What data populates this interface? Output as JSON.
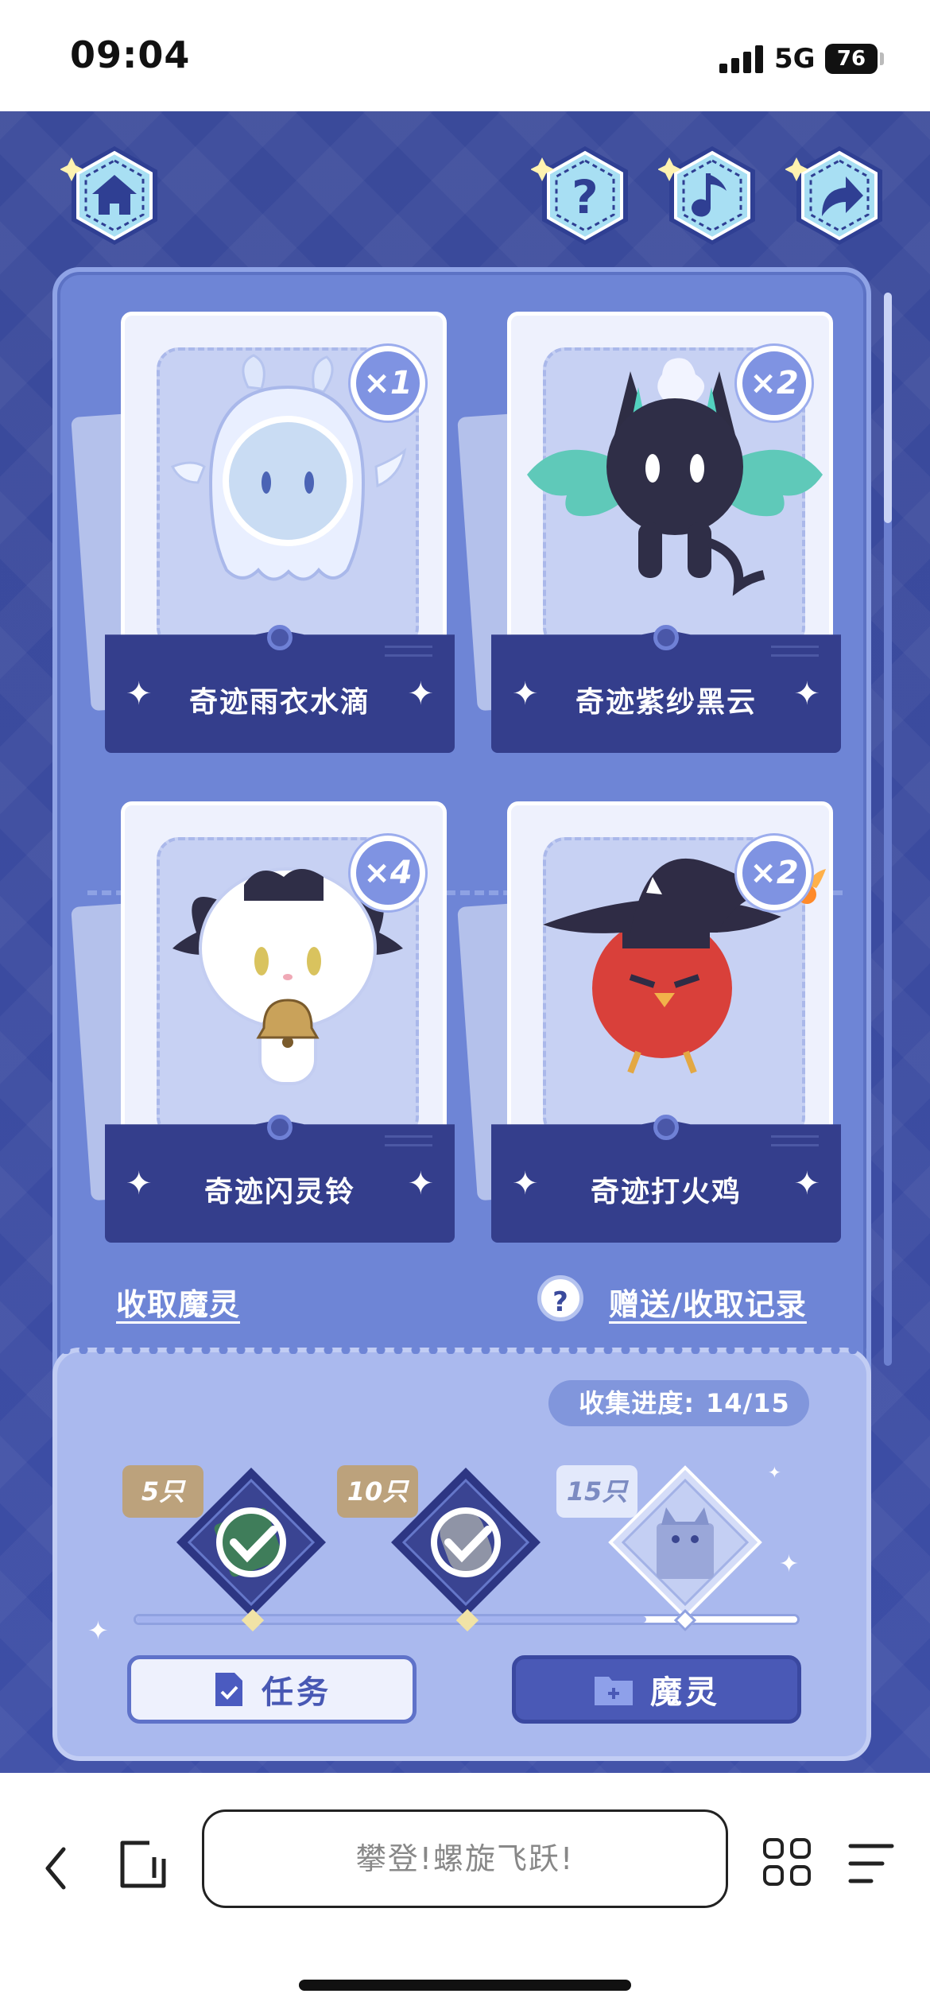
{
  "status_bar": {
    "time": "09:04",
    "network": "5G",
    "battery": "76"
  },
  "top_buttons": [
    {
      "icon": "home-icon"
    },
    {
      "icon": "help-icon",
      "glyph": "?"
    },
    {
      "icon": "music-icon"
    },
    {
      "icon": "share-icon"
    }
  ],
  "cards": [
    {
      "name": "奇迹雨衣水滴",
      "count": "×1"
    },
    {
      "name": "奇迹紫纱黑云",
      "count": "×2"
    },
    {
      "name": "奇迹闪灵铃",
      "count": "×4"
    },
    {
      "name": "奇迹打火鸡",
      "count": "×2"
    }
  ],
  "links": {
    "collect": "收取魔灵",
    "help_glyph": "?",
    "records": "赠送/收取记录"
  },
  "progress": {
    "label": "收集进度:",
    "value": "14/15",
    "current": 14,
    "total": 15,
    "milestones": [
      {
        "tag": "5只",
        "status": "claimed"
      },
      {
        "tag": "10只",
        "status": "claimed"
      },
      {
        "tag": "15只",
        "status": "locked"
      }
    ]
  },
  "tabs": {
    "task": "任务",
    "pet": "魔灵"
  },
  "browser": {
    "url_text": "攀登!螺旋飞跃!"
  },
  "colors": {
    "panel": "#6e85d6",
    "nameplate": "#343e8c",
    "background": "#3a4a9a",
    "progress_panel": "#aab9ee"
  }
}
